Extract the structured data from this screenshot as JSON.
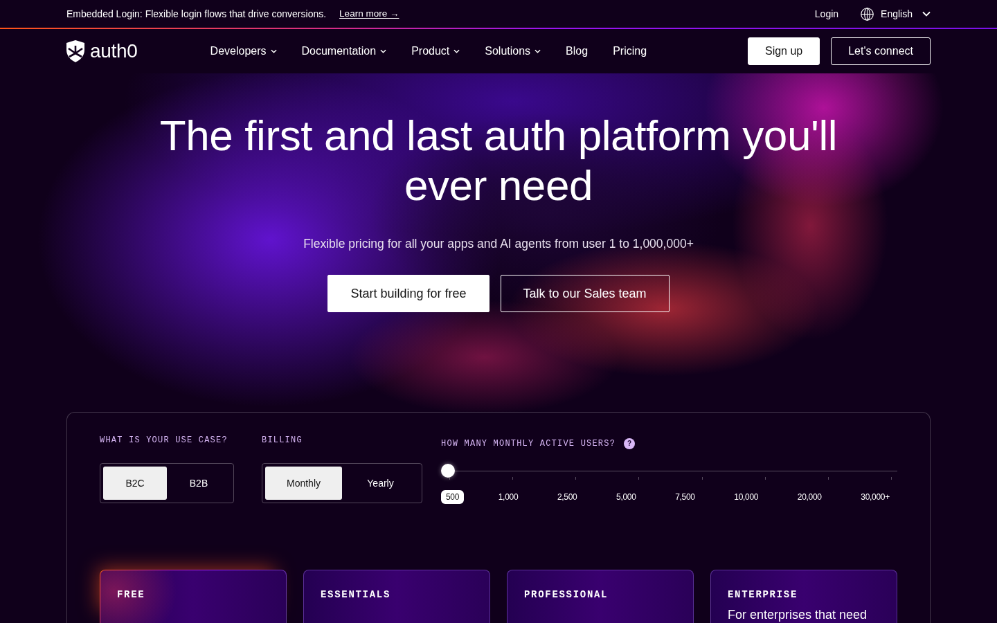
{
  "announcement": {
    "text": "Embedded Login: Flexible login flows that drive conversions.",
    "link": "Learn more →"
  },
  "utility_nav": {
    "login": "Login",
    "language": "English"
  },
  "nav": {
    "logo": "auth0",
    "items": [
      {
        "label": "Developers",
        "has_menu": true
      },
      {
        "label": "Documentation",
        "has_menu": true
      },
      {
        "label": "Product",
        "has_menu": true
      },
      {
        "label": "Solutions",
        "has_menu": true
      },
      {
        "label": "Blog",
        "has_menu": false
      },
      {
        "label": "Pricing",
        "has_menu": false
      }
    ],
    "buttons": [
      {
        "label": "Sign up",
        "kind": "primary"
      },
      {
        "label": "Let's connect",
        "kind": "outline"
      }
    ]
  },
  "hero": {
    "title": "The first and last auth platform you'll ever need",
    "subtitle": "Flexible pricing for all your apps and AI agents from user 1 to 1,000,000+",
    "buttons": [
      {
        "label": "Start building for free",
        "kind": "primary"
      },
      {
        "label": "Talk to our Sales team",
        "kind": "outline"
      }
    ]
  },
  "pricing": {
    "use_case": {
      "label": "WHAT IS YOUR USE CASE?",
      "options": [
        {
          "label": "B2C",
          "selected": true
        },
        {
          "label": "B2B",
          "selected": false
        }
      ]
    },
    "billing": {
      "label": "BILLING",
      "options": [
        {
          "label": "Monthly",
          "selected": true
        },
        {
          "label": "Yearly",
          "selected": false
        }
      ]
    },
    "users": {
      "label": "HOW MANY MONTHLY ACTIVE USERS?",
      "hint": "?",
      "level": 0,
      "stops": [
        {
          "label": "500",
          "selected": true
        },
        {
          "label": "1,000",
          "selected": false
        },
        {
          "label": "2,500",
          "selected": false
        },
        {
          "label": "5,000",
          "selected": false
        },
        {
          "label": "7,500",
          "selected": false
        },
        {
          "label": "10,000",
          "selected": false
        },
        {
          "label": "20,000",
          "selected": false
        },
        {
          "label": "30,000+",
          "selected": false
        }
      ]
    },
    "plans": [
      {
        "name": "FREE",
        "highlighted": true
      },
      {
        "name": "ESSENTIALS",
        "highlighted": false
      },
      {
        "name": "PROFESSIONAL",
        "highlighted": false
      },
      {
        "name": "ENTERPRISE",
        "highlighted": false,
        "description": "For enterprises that need"
      }
    ]
  }
}
